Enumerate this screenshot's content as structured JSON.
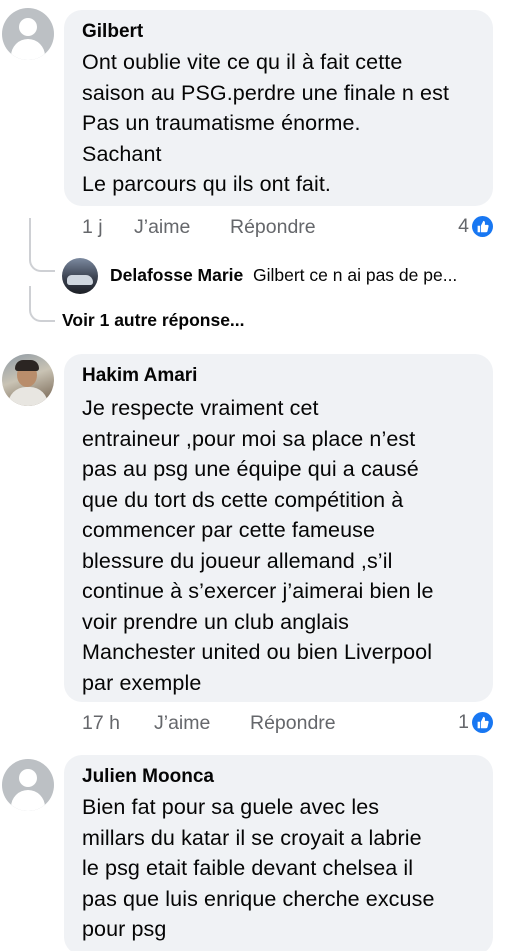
{
  "comments": [
    {
      "author": "Gilbert",
      "text": "Ont oublie vite ce qu il à fait cette\nsaison au PSG.perdre une finale n est\nPas un traumatisme énorme.\nSachant\nLe parcours qu ils ont fait.",
      "time": "1 j",
      "like_label": "J’aime",
      "reply_label": "Répondre",
      "reaction_count": "4"
    },
    {
      "author": "Hakim Amari",
      "text": "Je respecte vraiment cet\nentraineur ,pour moi sa place n’est\npas au psg une équipe qui a causé\nque du tort ds cette compétition à\ncommencer par cette fameuse\nblessure du joueur allemand ,s’il\ncontinue à s’exercer j’aimerai bien le\nvoir prendre un club anglais\nManchester united ou bien  Liverpool\npar exemple",
      "time": "17 h",
      "like_label": "J’aime",
      "reply_label": "Répondre",
      "reaction_count": "1"
    },
    {
      "author": "Julien Moonca",
      "text": "Bien fat pour sa guele avec les\nmillars du katar il se croyait a labrie\nle psg etait faible devant chelsea il\npas que luis enrique cherche excuse\npour psg"
    }
  ],
  "reply_preview": {
    "author": "Delafosse Marie",
    "mention": "Gilbert",
    "text": " ce n ai pas de pe..."
  },
  "more_replies_label": "Voir 1 autre réponse...",
  "colors": {
    "bubble": "#f0f2f5",
    "like_blue": "#1877f2",
    "meta_gray": "#65676b"
  },
  "icons": [
    "default-avatar-icon",
    "like-reaction-icon"
  ]
}
